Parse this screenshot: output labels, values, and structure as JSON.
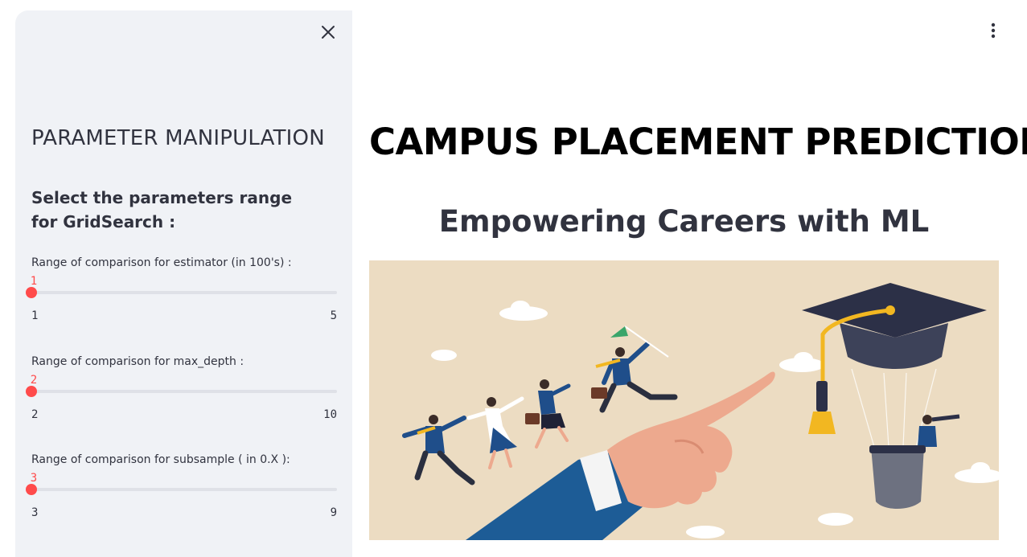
{
  "sidebar": {
    "title": "PARAMETER MANIPULATION",
    "subtitle": "Select the parameters range for GridSearch :",
    "sliders": [
      {
        "label": "Range of comparison for estimator (in 100's) :",
        "value": "1",
        "min": "1",
        "max": "5",
        "fraction": 0
      },
      {
        "label": "Range of comparison for max_depth :",
        "value": "2",
        "min": "2",
        "max": "10",
        "fraction": 0
      },
      {
        "label": "Range of comparison for subsample ( in 0.X ):",
        "value": "3",
        "min": "3",
        "max": "9",
        "fraction": 0
      }
    ]
  },
  "main": {
    "title": "CAMPUS PLACEMENT PREDICTION",
    "subtitle": "Empowering Careers with ML"
  },
  "icons": {
    "close": "close-icon",
    "menu": "more-vertical-icon"
  },
  "colors": {
    "accent": "#ff4b4b",
    "sidebar_bg": "#f0f2f6",
    "hero_bg": "#ecdcc2"
  }
}
